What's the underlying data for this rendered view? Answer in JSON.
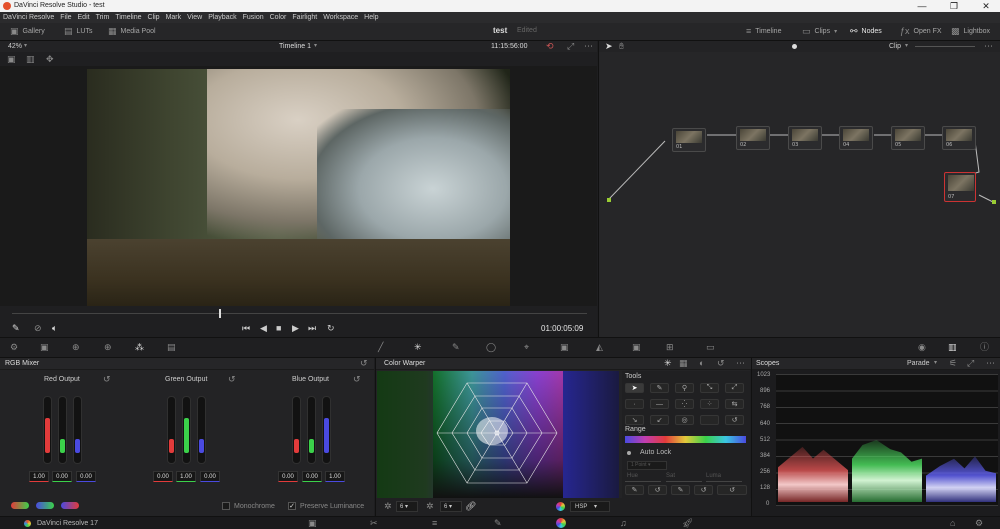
{
  "window": {
    "title": "DaVinci Resolve Studio - test"
  },
  "menu": [
    "DaVinci Resolve",
    "File",
    "Edit",
    "Trim",
    "Timeline",
    "Clip",
    "Mark",
    "View",
    "Playback",
    "Fusion",
    "Color",
    "Fairlight",
    "Workspace",
    "Help"
  ],
  "toolbar": {
    "gallery": "Gallery",
    "luts": "LUTs",
    "media_pool": "Media Pool",
    "project": "test",
    "edited": "Edited",
    "timeline": "Timeline",
    "clips": "Clips",
    "nodes": "Nodes",
    "openfx": "Open FX",
    "lightbox": "Lightbox"
  },
  "viewer": {
    "zoom": "42%",
    "timeline_name": "Timeline 1",
    "timecode": "11:15:56:00",
    "playhead_timecode": "01:00:05:09"
  },
  "nodes_panel": {
    "mode": "Clip"
  },
  "node_labels": [
    "01",
    "02",
    "03",
    "04",
    "05",
    "06",
    "07"
  ],
  "rgb_mixer": {
    "title": "RGB Mixer",
    "channels": [
      {
        "label": "Red Output",
        "values": [
          "1.00",
          "0.00",
          "0.00"
        ]
      },
      {
        "label": "Green Output",
        "values": [
          "0.00",
          "1.00",
          "0.00"
        ]
      },
      {
        "label": "Blue Output",
        "values": [
          "0.00",
          "0.00",
          "1.00"
        ]
      }
    ],
    "monochrome": "Monochrome",
    "preserve_luminance": "Preserve Luminance"
  },
  "color_warper": {
    "title": "Color Warper",
    "res1": "6",
    "res2": "6",
    "colorspace": "HSP",
    "tools_title": "Tools",
    "range_title": "Range",
    "auto_lock": "Auto Lock",
    "point": "1 Point",
    "hue": "Hue",
    "sat": "Sat",
    "luma": "Luma"
  },
  "scopes": {
    "title": "Scopes",
    "mode": "Parade",
    "scale": [
      "1023",
      "896",
      "768",
      "640",
      "512",
      "384",
      "256",
      "128",
      "0"
    ]
  },
  "footer": {
    "app": "DaVinci Resolve 17"
  },
  "colors": {
    "accent": "#e64b4b",
    "red": "#e23b3b",
    "green": "#3bd14a",
    "blue": "#4a4ae0"
  }
}
